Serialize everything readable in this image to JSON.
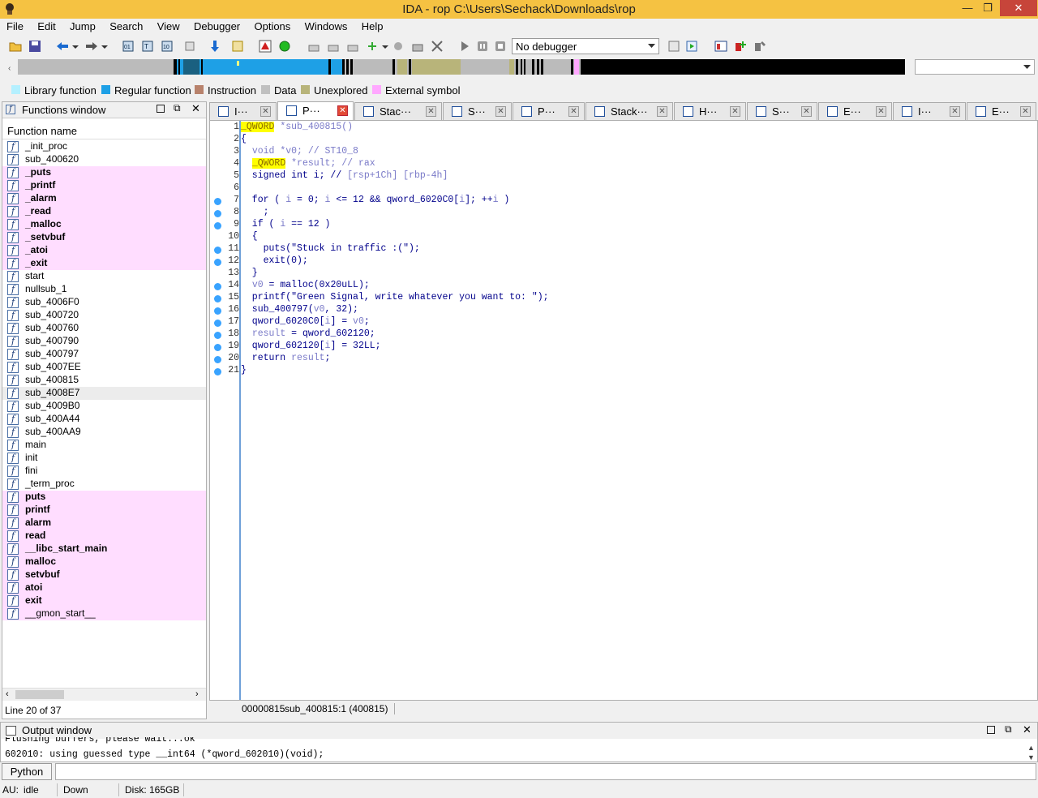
{
  "window": {
    "title": "IDA - rop C:\\Users\\Sechack\\Downloads\\rop"
  },
  "menu": [
    "File",
    "Edit",
    "Jump",
    "Search",
    "View",
    "Debugger",
    "Options",
    "Windows",
    "Help"
  ],
  "toolbar": {
    "debugger_select": "No debugger"
  },
  "legend": [
    {
      "label": "Library function",
      "color": "#b4f0ff"
    },
    {
      "label": "Regular function",
      "color": "#1ea0e6"
    },
    {
      "label": "Instruction",
      "color": "#b8826c"
    },
    {
      "label": "Data",
      "color": "#c0c0c0"
    },
    {
      "label": "Unexplored",
      "color": "#b8b47a"
    },
    {
      "label": "External symbol",
      "color": "#ffa8ff"
    }
  ],
  "functions_window": {
    "title": "Functions window",
    "column": "Function name",
    "items": [
      {
        "name": "_init_proc",
        "kind": "normal"
      },
      {
        "name": "sub_400620",
        "kind": "normal"
      },
      {
        "name": "_puts",
        "kind": "import"
      },
      {
        "name": "_printf",
        "kind": "import"
      },
      {
        "name": "_alarm",
        "kind": "import"
      },
      {
        "name": "_read",
        "kind": "import"
      },
      {
        "name": "_malloc",
        "kind": "import"
      },
      {
        "name": "_setvbuf",
        "kind": "import"
      },
      {
        "name": "_atoi",
        "kind": "import"
      },
      {
        "name": "_exit",
        "kind": "import"
      },
      {
        "name": "start",
        "kind": "normal"
      },
      {
        "name": "nullsub_1",
        "kind": "normal"
      },
      {
        "name": "sub_4006F0",
        "kind": "normal"
      },
      {
        "name": "sub_400720",
        "kind": "normal"
      },
      {
        "name": "sub_400760",
        "kind": "normal"
      },
      {
        "name": "sub_400790",
        "kind": "normal"
      },
      {
        "name": "sub_400797",
        "kind": "normal"
      },
      {
        "name": "sub_4007EE",
        "kind": "normal"
      },
      {
        "name": "sub_400815",
        "kind": "normal"
      },
      {
        "name": "sub_4008E7",
        "kind": "selected"
      },
      {
        "name": "sub_4009B0",
        "kind": "normal"
      },
      {
        "name": "sub_400A44",
        "kind": "normal"
      },
      {
        "name": "sub_400AA9",
        "kind": "normal"
      },
      {
        "name": "main",
        "kind": "normal"
      },
      {
        "name": "init",
        "kind": "normal"
      },
      {
        "name": "fini",
        "kind": "normal"
      },
      {
        "name": "_term_proc",
        "kind": "normal"
      },
      {
        "name": "puts",
        "kind": "import"
      },
      {
        "name": "printf",
        "kind": "import"
      },
      {
        "name": "alarm",
        "kind": "import"
      },
      {
        "name": "read",
        "kind": "import"
      },
      {
        "name": "__libc_start_main",
        "kind": "import"
      },
      {
        "name": "malloc",
        "kind": "import"
      },
      {
        "name": "setvbuf",
        "kind": "import"
      },
      {
        "name": "atoi",
        "kind": "import"
      },
      {
        "name": "exit",
        "kind": "import"
      },
      {
        "name": "__gmon_start__",
        "kind": "import_plain"
      }
    ],
    "status": "Line 20 of 37"
  },
  "tabs": [
    {
      "label": "I···",
      "active": false
    },
    {
      "label": "P···",
      "active": true
    },
    {
      "label": "Stac···",
      "active": false
    },
    {
      "label": "S···",
      "active": false
    },
    {
      "label": "P···",
      "active": false
    },
    {
      "label": "Stack···",
      "active": false
    },
    {
      "label": "H···",
      "active": false
    },
    {
      "label": "S···",
      "active": false
    },
    {
      "label": "E···",
      "active": false
    },
    {
      "label": "I···",
      "active": false
    },
    {
      "label": "E···",
      "active": false
    }
  ],
  "pseudocode": {
    "lines": [
      {
        "n": "1",
        "dot": false
      },
      {
        "n": "2",
        "dot": false
      },
      {
        "n": "3",
        "dot": false
      },
      {
        "n": "4",
        "dot": false
      },
      {
        "n": "5",
        "dot": false
      },
      {
        "n": "6",
        "dot": false
      },
      {
        "n": "7",
        "dot": true
      },
      {
        "n": "8",
        "dot": true
      },
      {
        "n": "9",
        "dot": true
      },
      {
        "n": "10",
        "dot": false
      },
      {
        "n": "11",
        "dot": true
      },
      {
        "n": "12",
        "dot": true
      },
      {
        "n": "13",
        "dot": false
      },
      {
        "n": "14",
        "dot": true
      },
      {
        "n": "15",
        "dot": true
      },
      {
        "n": "16",
        "dot": true
      },
      {
        "n": "17",
        "dot": true
      },
      {
        "n": "18",
        "dot": true
      },
      {
        "n": "19",
        "dot": true
      },
      {
        "n": "20",
        "dot": true
      },
      {
        "n": "21",
        "dot": true
      }
    ],
    "status_address": "00000815",
    "status_location": "sub_400815:1 (400815)"
  },
  "output_window": {
    "title": "Output window",
    "lines": [
      "Flushing buffers, please wait...ok",
      "602010: using guessed type __int64 (*qword_602010)(void);"
    ]
  },
  "python_button": "Python",
  "statusbar": {
    "au": "AU:",
    "state": "idle",
    "direction": "Down",
    "disk": "Disk: 165GB"
  }
}
